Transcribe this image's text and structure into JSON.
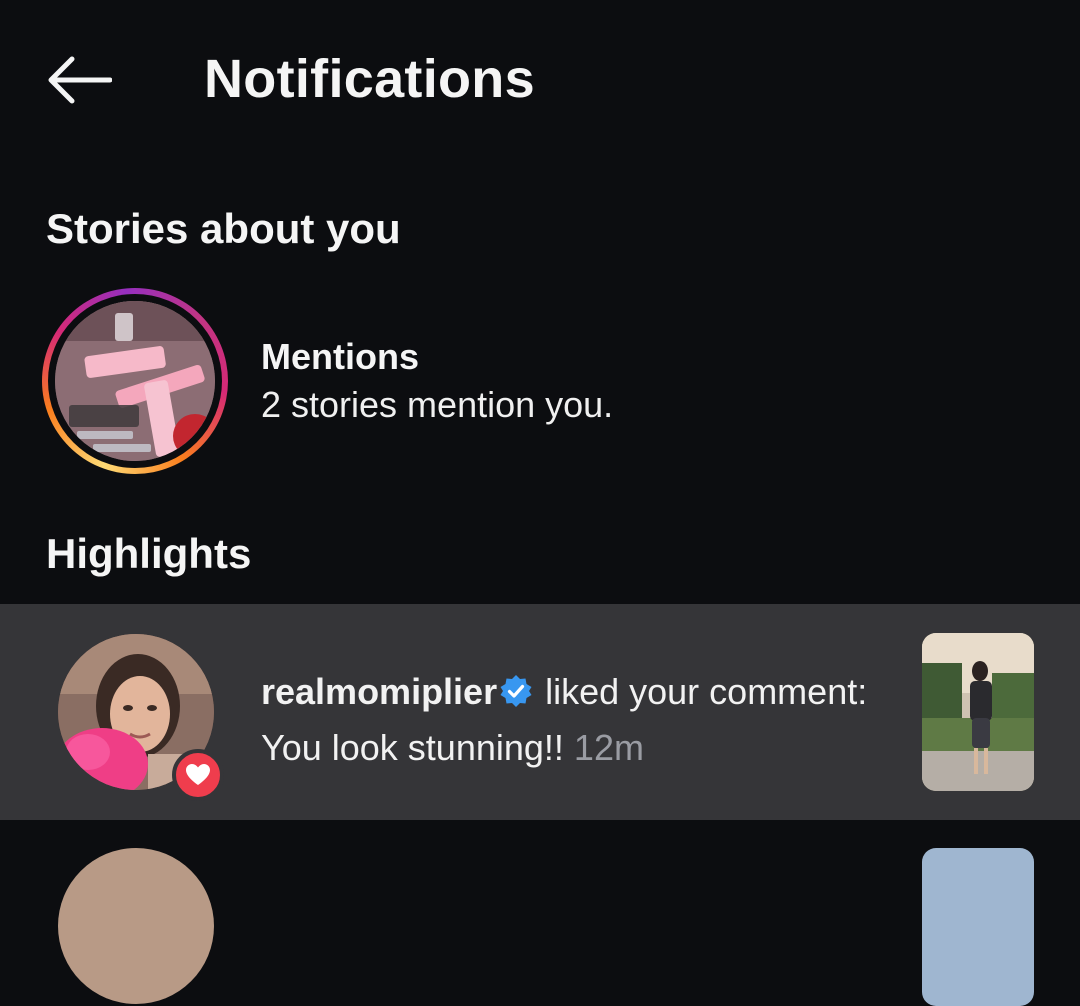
{
  "header": {
    "back_icon": "arrow-left-icon",
    "title": "Notifications"
  },
  "stories_section": {
    "title": "Stories about you",
    "mentions": {
      "title": "Mentions",
      "subtitle": "2 stories mention you."
    }
  },
  "highlights_section": {
    "title": "Highlights",
    "items": [
      {
        "username": "realmomiplier",
        "verified": true,
        "action_text": " liked your comment: You look stunning!! ",
        "time": "12m",
        "badge_icon": "heart-icon"
      }
    ]
  },
  "colors": {
    "background": "#0c0d10",
    "highlight_row": "#353538",
    "like_badge": "#ef3d4d",
    "verified_badge": "#3897f0",
    "muted_text": "#9a9ca3"
  }
}
